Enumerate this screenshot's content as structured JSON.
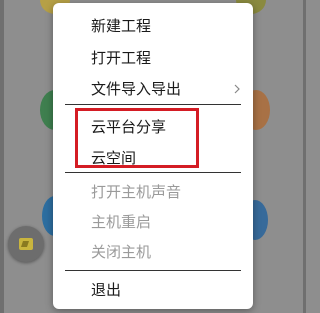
{
  "menu": {
    "items": [
      {
        "label": "新建工程",
        "enabled": true
      },
      {
        "label": "打开工程",
        "enabled": true
      },
      {
        "label": "文件导入导出",
        "enabled": true,
        "submenu": true
      },
      {
        "label": "云平台分享",
        "enabled": true,
        "highlighted": true
      },
      {
        "label": "云空间",
        "enabled": true,
        "highlighted": true
      },
      {
        "label": "打开主机声音",
        "enabled": false
      },
      {
        "label": "主机重启",
        "enabled": false
      },
      {
        "label": "关闭主机",
        "enabled": false
      },
      {
        "label": "退出",
        "enabled": true
      }
    ],
    "highlight_color": "#d41c24",
    "disabled_color": "#9a9a9a"
  },
  "icons": {
    "submenu": "chevron-right-icon",
    "fab": "app-logo-icon"
  }
}
